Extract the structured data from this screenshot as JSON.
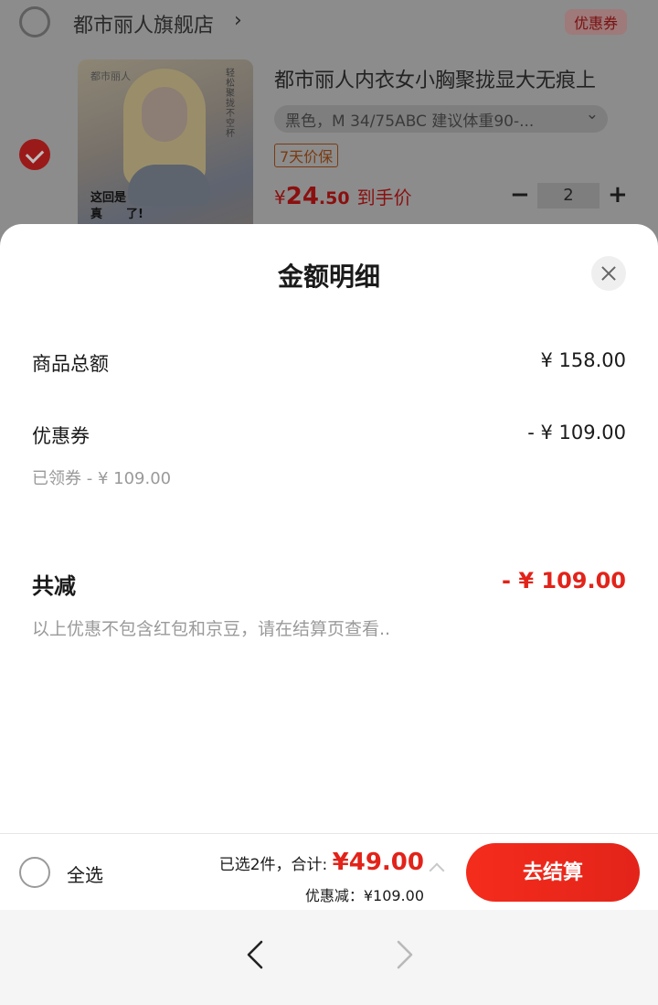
{
  "shop": {
    "name": "都市丽人旗舰店",
    "arrow": "›",
    "coupon_tag": "优惠券"
  },
  "product": {
    "thumb_brand": "都市丽人",
    "thumb_side_text": "轻松聚拢不空杯",
    "thumb_promo_line1": "这回是",
    "thumb_promo_line2": "真　　了!",
    "title": "都市丽人内衣女小胸聚拢显大无痕上",
    "variant": "黑色，M 34/75ABC 建议体重90-...",
    "variant_chevron": "⌄",
    "price_protect": "7天价保",
    "price_symbol": "¥",
    "price_int": "24",
    "price_dec": ".50",
    "price_note": "到手价",
    "qty_minus": "−",
    "qty_plus": "+",
    "quantity": "2"
  },
  "sheet": {
    "title": "金额明细",
    "goods_total_label": "商品总额",
    "goods_total_value": "¥ 158.00",
    "coupon_label": "优惠券",
    "coupon_value": "- ¥ 109.00",
    "coupon_note": "已领券 - ¥ 109.00",
    "total_reduce_label": "共减",
    "total_reduce_value": "- ¥ 109.00",
    "disclaimer": "以上优惠不包含红包和京豆，请在结算页查看.."
  },
  "bottom_bar": {
    "select_all": "全选",
    "selected_text": "已选2件，合计: ",
    "total_amount": "¥49.00",
    "discount_text": "优惠减：¥109.00",
    "checkout": "去结算"
  },
  "colors": {
    "accent_red": "#e2231a",
    "muted_gray": "#9a9a9a"
  },
  "icons": {
    "close": "close-icon",
    "back": "chevron-left-icon",
    "forward": "chevron-right-icon",
    "expand": "chevron-up-icon"
  }
}
